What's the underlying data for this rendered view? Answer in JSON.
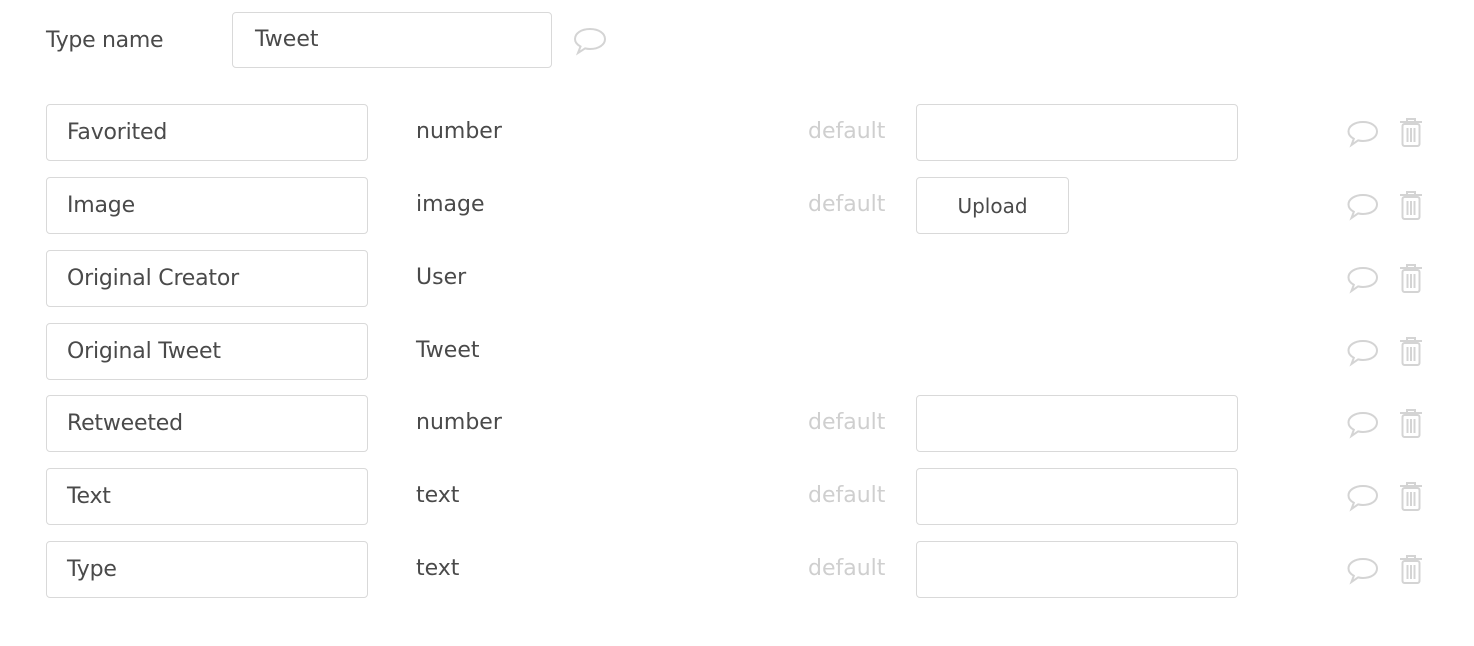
{
  "header": {
    "type_name_label": "Type name",
    "type_name_value": "Tweet",
    "comment_icon": "comment-icon"
  },
  "default_label": "default",
  "upload_label": "Upload",
  "fields": [
    {
      "name": "Favorited",
      "type": "number",
      "default_kind": "input",
      "default_value": ""
    },
    {
      "name": "Image",
      "type": "image",
      "default_kind": "upload",
      "default_value": ""
    },
    {
      "name": "Original Creator",
      "type": "User",
      "default_kind": "none",
      "default_value": ""
    },
    {
      "name": "Original Tweet",
      "type": "Tweet",
      "default_kind": "none",
      "default_value": ""
    },
    {
      "name": "Retweeted",
      "type": "number",
      "default_kind": "input",
      "default_value": ""
    },
    {
      "name": "Text",
      "type": "text",
      "default_kind": "input",
      "default_value": ""
    },
    {
      "name": "Type",
      "type": "text",
      "default_kind": "input",
      "default_value": ""
    }
  ],
  "row_icons": [
    "comment-icon",
    "trash-icon"
  ]
}
